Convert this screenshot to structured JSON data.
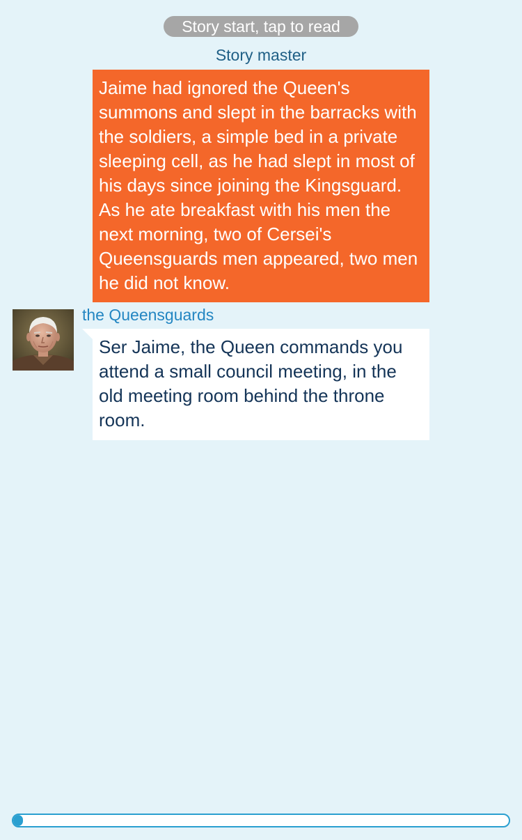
{
  "header": {
    "start_label": "Story start, tap to read"
  },
  "messages": [
    {
      "speaker": "Story master",
      "text": "Jaime had ignored the Queen's summons and slept in the barracks with the soldiers, a simple bed in a private sleeping cell, as he had slept in most of his days since joining the Kingsguard. As he ate breakfast with his men the next morning, two of Cersei's Queensguards men appeared, two men he did not know.",
      "bubble_color": "#f4672a"
    },
    {
      "speaker": "the Queensguards",
      "text": "Ser Jaime, the Queen commands you attend a small council meeting, in the old meeting room behind the throne room.",
      "bubble_color": "#ffffff",
      "avatar": "elderly-man-portrait"
    }
  ],
  "progress": {
    "fraction": 0.02
  },
  "colors": {
    "background": "#e4f3f9",
    "accent": "#2a9fd0",
    "narrator_name": "#1f5f86",
    "character_name": "#2386c2"
  }
}
